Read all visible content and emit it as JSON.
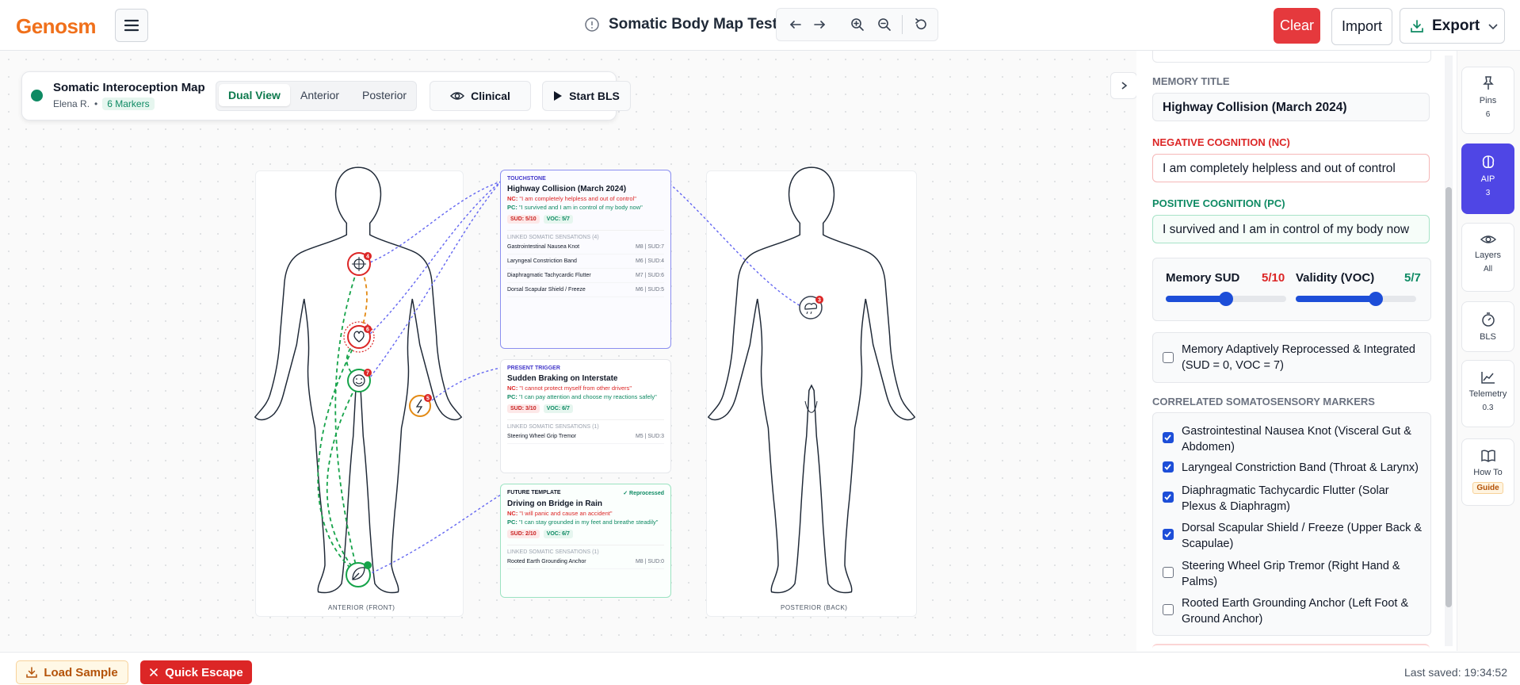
{
  "app": {
    "logo": "Genosm",
    "title": "Somatic Body Map Test"
  },
  "header": {
    "clear_label": "Clear",
    "import_label": "Import",
    "export_label": "Export"
  },
  "map": {
    "title": "Somatic Interoception Map",
    "client": "Elena R.",
    "markers_badge": "6 Markers",
    "views": [
      "Dual View",
      "Anterior",
      "Posterior"
    ],
    "clinical_label": "Clinical",
    "bls_label": "Start BLS",
    "anterior_label": "ANTERIOR (FRONT)",
    "posterior_label": "POSTERIOR (BACK)"
  },
  "pins": [
    "4",
    "6",
    "7",
    "5",
    "3"
  ],
  "memory_cards": [
    {
      "tag": "TOUCHSTONE",
      "title": "Highway Collision (March 2024)",
      "nc": "\"I am completely helpless and out of control\"",
      "pc": "\"I survived and I am in control of my body now\"",
      "sud": "SUD: 5/10",
      "voc": "VOC: 5/7",
      "linked_head": "LINKED SOMATIC SENSATIONS (4)",
      "linked": [
        {
          "name": "Gastrointestinal Nausea Knot",
          "meta": "M8 | SUD:7"
        },
        {
          "name": "Laryngeal Constriction Band",
          "meta": "M6 | SUD:4"
        },
        {
          "name": "Diaphragmatic Tachycardic Flutter",
          "meta": "M7 | SUD:6"
        },
        {
          "name": "Dorsal Scapular Shield / Freeze",
          "meta": "M6 | SUD:5"
        }
      ]
    },
    {
      "tag": "PRESENT TRIGGER",
      "title": "Sudden Braking on Interstate",
      "nc": "\"I cannot protect myself from other drivers\"",
      "pc": "\"I can pay attention and choose my reactions safely\"",
      "sud": "SUD: 3/10",
      "voc": "VOC: 6/7",
      "linked_head": "LINKED SOMATIC SENSATIONS (1)",
      "linked": [
        {
          "name": "Steering Wheel Grip Tremor",
          "meta": "M5 | SUD:3"
        }
      ]
    },
    {
      "tag": "FUTURE TEMPLATE",
      "status": "✓ Reprocessed",
      "title": "Driving on Bridge in Rain",
      "nc": "\"I will panic and cause an accident\"",
      "pc": "\"I can stay grounded in my feet and breathe steadily\"",
      "sud": "SUD: 2/10",
      "voc": "VOC: 6/7",
      "linked_head": "LINKED SOMATIC SENSATIONS (1)",
      "linked": [
        {
          "name": "Rooted Earth Grounding Anchor",
          "meta": "M8 | SUD:0"
        }
      ]
    }
  ],
  "form": {
    "memory_title_label": "MEMORY TITLE",
    "memory_title": "Highway Collision (March 2024)",
    "nc_label": "NEGATIVE COGNITION (NC)",
    "nc_value": "I am completely helpless and out of control",
    "pc_label": "POSITIVE COGNITION (PC)",
    "pc_value": "I survived and I am in control of my body now",
    "sud_label": "Memory SUD",
    "sud_value": "5/10",
    "sud_level": 0.5,
    "voc_label": "Validity (VOC)",
    "voc_value": "5/7",
    "voc_level": 0.667,
    "reprocessed_label": "Memory Adaptively Reprocessed & Integrated (SUD = 0, VOC = 7)",
    "markers_label": "CORRELATED SOMATOSENSORY MARKERS",
    "markers": [
      {
        "label": "Gastrointestinal Nausea Knot (Visceral Gut & Abdomen)",
        "checked": true
      },
      {
        "label": "Laryngeal Constriction Band (Throat & Larynx)",
        "checked": true
      },
      {
        "label": "Diaphragmatic Tachycardic Flutter (Solar Plexus & Diaphragm)",
        "checked": true
      },
      {
        "label": "Dorsal Scapular Shield / Freeze (Upper Back & Scapulae)",
        "checked": true
      },
      {
        "label": "Steering Wheel Grip Tremor (Right Hand & Palms)",
        "checked": false
      },
      {
        "label": "Rooted Earth Grounding Anchor (Left Foot & Ground Anchor)",
        "checked": false
      }
    ]
  },
  "rail": [
    {
      "label": "Pins",
      "count": "6",
      "icon": "pin-icon"
    },
    {
      "label": "AIP",
      "count": "3",
      "icon": "brain-icon"
    },
    {
      "label": "Layers",
      "count": "All",
      "icon": "eye-icon"
    },
    {
      "label": "BLS",
      "count": "",
      "icon": "timer-icon"
    },
    {
      "label": "Telemetry",
      "count": "0.3",
      "icon": "chart-icon"
    },
    {
      "label": "How To",
      "count": "Guide",
      "icon": "book-icon"
    }
  ],
  "footer": {
    "load_label": "Load Sample",
    "escape_label": "Quick Escape",
    "saved": "Last saved: 19:34:52"
  }
}
